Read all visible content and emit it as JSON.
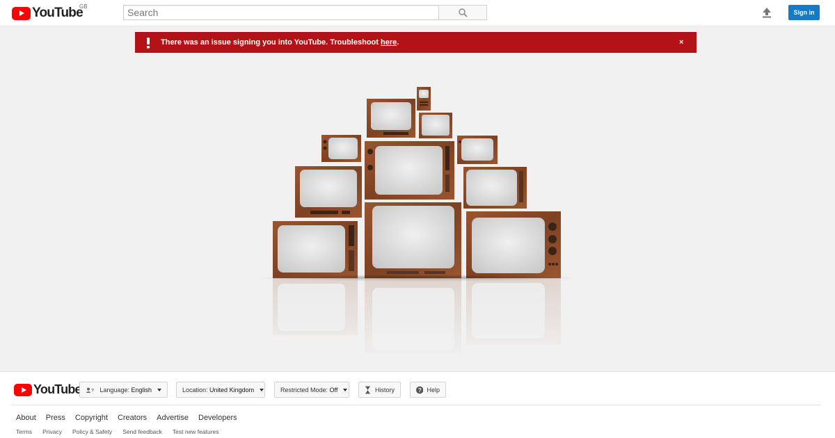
{
  "header": {
    "logo_text": "YouTube",
    "country_code": "GB",
    "search_placeholder": "Search",
    "sign_in_label": "Sign in"
  },
  "alert": {
    "message_prefix": "There was an issue signing you into YouTube. Troubleshoot ",
    "link_text": "here",
    "message_suffix": ".",
    "close_glyph": "×",
    "color": "#b31217"
  },
  "footer": {
    "logo_text": "YouTube",
    "language_label": "Language:",
    "language_value": "English",
    "location_label": "Location:",
    "location_value": "United Kingdom",
    "restricted_label": "Restricted Mode:",
    "restricted_value": "Off",
    "history_label": "History",
    "help_label": "Help",
    "primary_links": [
      "About",
      "Press",
      "Copyright",
      "Creators",
      "Advertise",
      "Developers"
    ],
    "secondary_links": [
      "Terms",
      "Privacy",
      "Policy & Safety",
      "Send feedback",
      "Test new features"
    ]
  },
  "colors": {
    "brand_red": "#ff0000",
    "sign_in_blue": "#167ac6",
    "tv_wood": "#8b4a2a"
  },
  "icons": {
    "upload": "upload-icon",
    "search": "search-icon",
    "alert": "exclamation-icon",
    "language": "people-icon",
    "history": "hourglass-icon",
    "help": "help-icon"
  }
}
